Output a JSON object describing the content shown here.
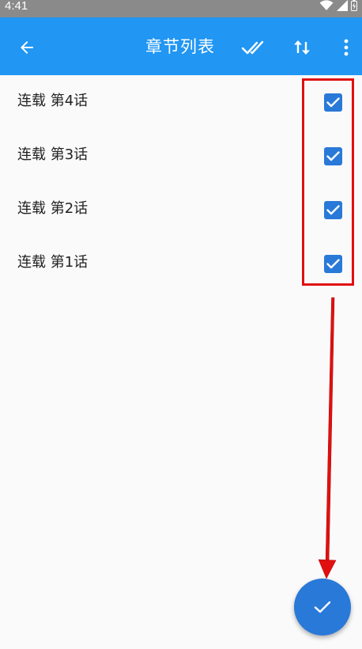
{
  "status_bar": {
    "time": "4:41",
    "icons": [
      "wifi-icon",
      "signal-icon",
      "battery-charging-icon"
    ],
    "background": "#8a8a8a"
  },
  "app_bar": {
    "title": "章节列表",
    "background": "#2196f3",
    "actions": [
      "back-arrow-icon",
      "double-check-icon",
      "sort-icon",
      "more-vert-icon"
    ]
  },
  "chapters": [
    {
      "label": "连载 第4话",
      "checked": true
    },
    {
      "label": "连载 第3话",
      "checked": true
    },
    {
      "label": "连载 第2话",
      "checked": true
    },
    {
      "label": "连载 第1话",
      "checked": true
    }
  ],
  "fab": {
    "icon": "check-icon",
    "color": "#2979d8"
  },
  "annotation": {
    "color": "#e01010"
  }
}
